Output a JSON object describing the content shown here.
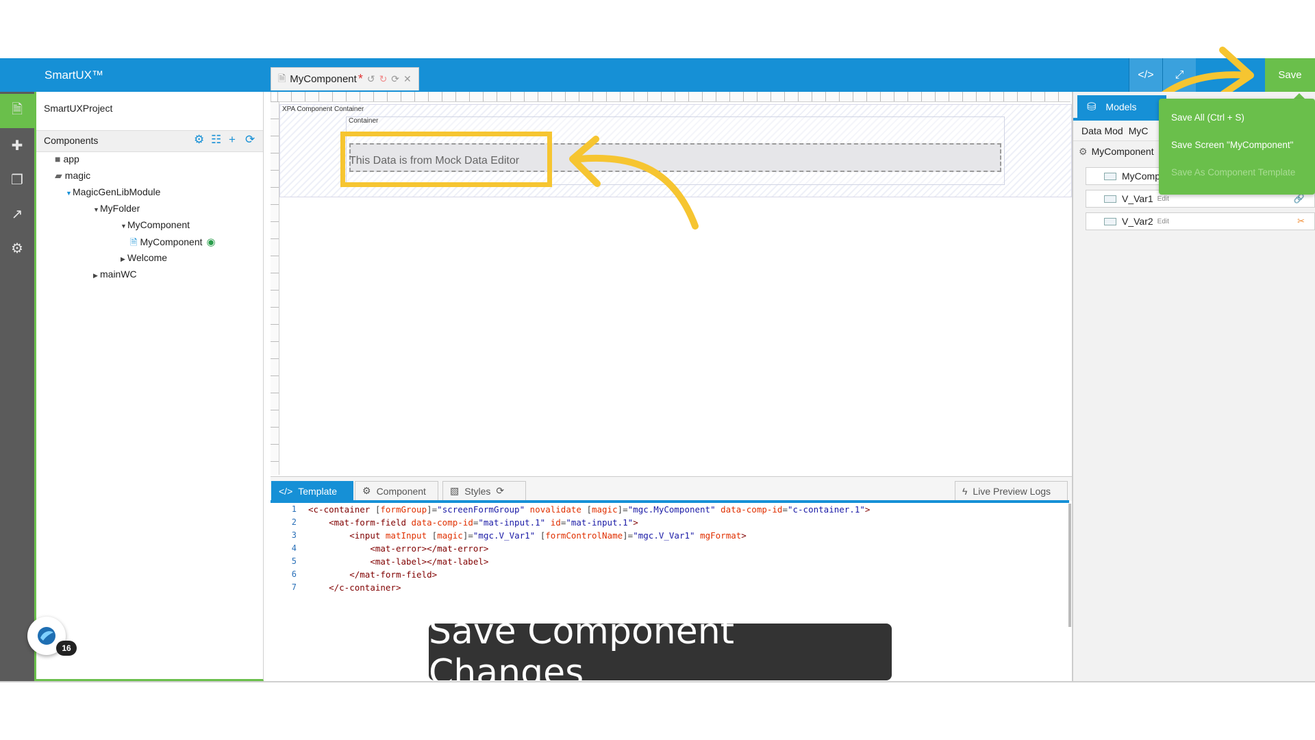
{
  "app": {
    "brand": "SmartUX™",
    "save_label": "Save"
  },
  "document_tab": {
    "title": "MyComponent",
    "dirty_marker": "*"
  },
  "toolbar": {
    "code_icon": "code-icon",
    "expand_icon": "expand-icon"
  },
  "left_panel": {
    "project": "SmartUXProject",
    "components_title": "Components",
    "tree": {
      "app": "app",
      "magic": "magic",
      "module": "MagicGenLibModule",
      "folder": "MyFolder",
      "component_folder": "MyComponent",
      "component_file": "MyComponent",
      "welcome": "Welcome",
      "mainwc": "mainWC"
    }
  },
  "canvas": {
    "xpa_label": "XPA Component Container",
    "container_label": "Container",
    "mock_text": "This Data is from Mock Data Editor"
  },
  "editor": {
    "tabs": {
      "template": "Template",
      "component": "Component",
      "styles": "Styles",
      "logs": "Live Preview Logs"
    },
    "line_numbers": [
      "1",
      "2",
      "3",
      "4",
      "5",
      "6",
      "7"
    ]
  },
  "right_panel": {
    "models_tab": "Models",
    "data_model_label": "Data Mod",
    "data_model_value": "MyC",
    "root": "MyComponent",
    "child": "MyComp",
    "vars": [
      {
        "name": "V_Var1",
        "edit": "Edit"
      },
      {
        "name": "V_Var2",
        "edit": "Edit"
      }
    ]
  },
  "save_menu": {
    "save_all": "Save All (Ctrl + S)",
    "save_screen": "Save Screen \"MyComponent\"",
    "save_template": "Save As Component Template"
  },
  "caption": "Save Component Changes",
  "badge_count": "16",
  "colors": {
    "accent": "#1690d6",
    "save_green": "#6abf4b",
    "highlight": "#f6c531"
  }
}
